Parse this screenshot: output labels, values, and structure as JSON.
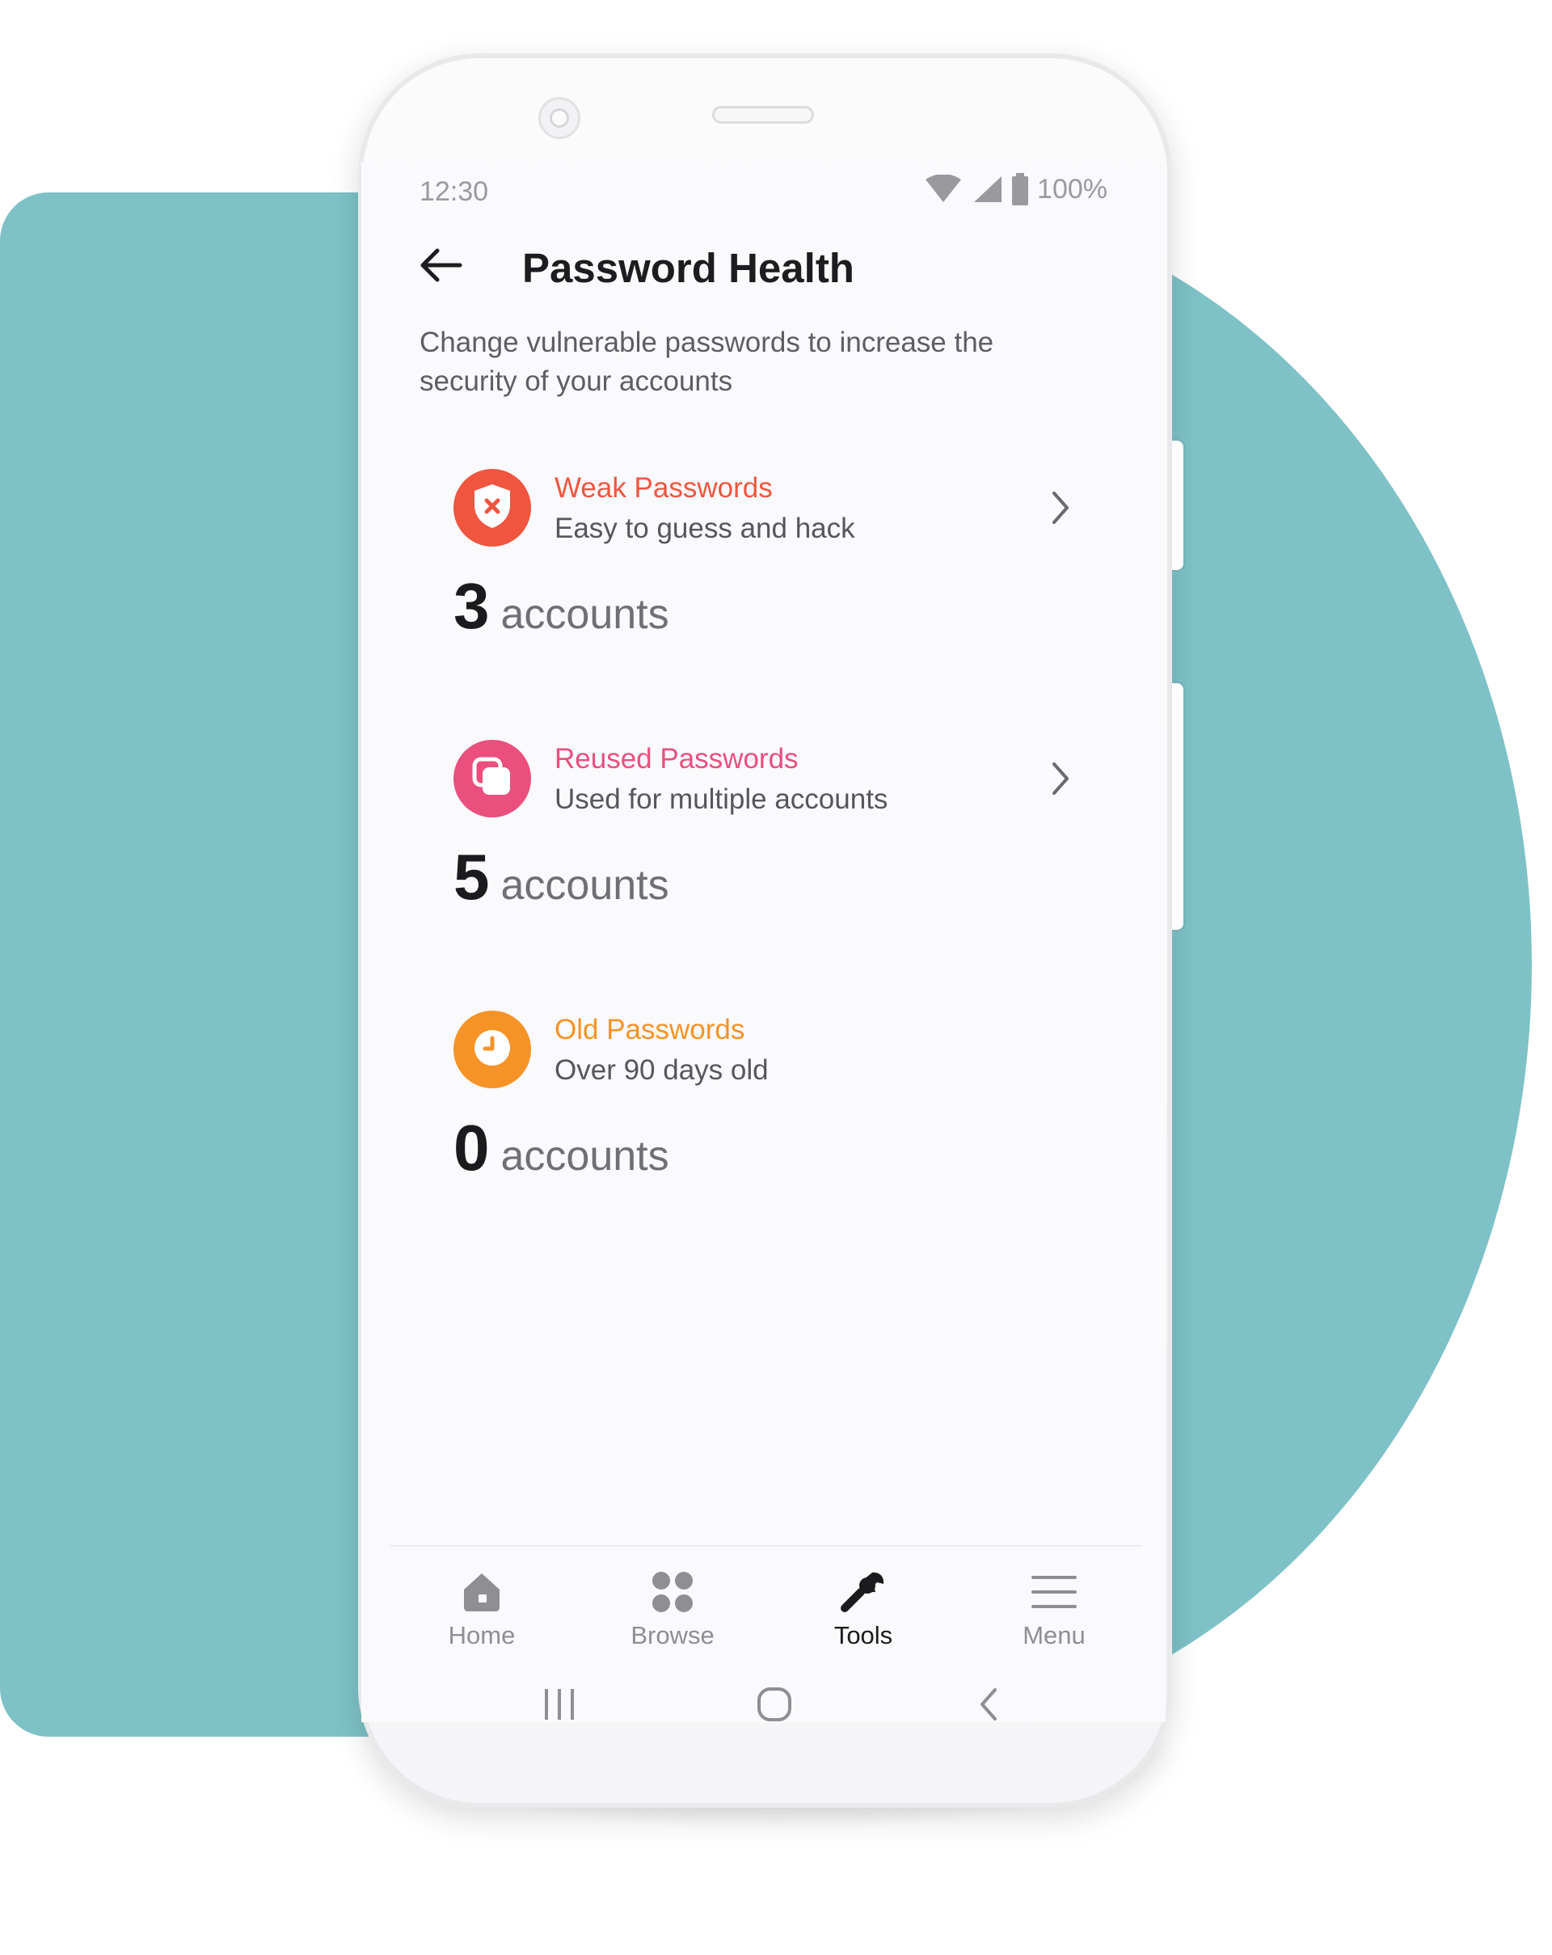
{
  "colors": {
    "background_teal": "#7ec2c7",
    "weak": "#f0553f",
    "reused": "#ea4f7d",
    "old": "#f69327"
  },
  "status_bar": {
    "time": "12:30",
    "battery": "100%",
    "icons": [
      "wifi-icon",
      "signal-icon",
      "battery-icon"
    ]
  },
  "header": {
    "back_icon": "arrow-left-icon",
    "title": "Password Health"
  },
  "subtitle": "Change vulnerable passwords to increase the security of your accounts",
  "cards": [
    {
      "title": "Weak Passwords",
      "description": "Easy to guess and hack",
      "count": "3",
      "unit": "accounts",
      "icon": "shield-x-icon",
      "color": "#f0553f",
      "has_chevron": true
    },
    {
      "title": "Reused Passwords",
      "description": "Used for multiple accounts",
      "count": "5",
      "unit": "accounts",
      "icon": "copy-icon",
      "color": "#ea4f7d",
      "has_chevron": true
    },
    {
      "title": "Old Passwords",
      "description": "Over 90 days old",
      "count": "0",
      "unit": "accounts",
      "icon": "clock-icon",
      "color": "#f69327",
      "has_chevron": false
    }
  ],
  "bottom_nav": [
    {
      "label": "Home",
      "icon": "home-icon",
      "active": false
    },
    {
      "label": "Browse",
      "icon": "grid-icon",
      "active": false
    },
    {
      "label": "Tools",
      "icon": "wrench-icon",
      "active": true
    },
    {
      "label": "Menu",
      "icon": "hamburger-icon",
      "active": false
    }
  ],
  "system_nav": [
    "recent-apps-icon",
    "home-circle-icon",
    "back-chevron-icon"
  ]
}
